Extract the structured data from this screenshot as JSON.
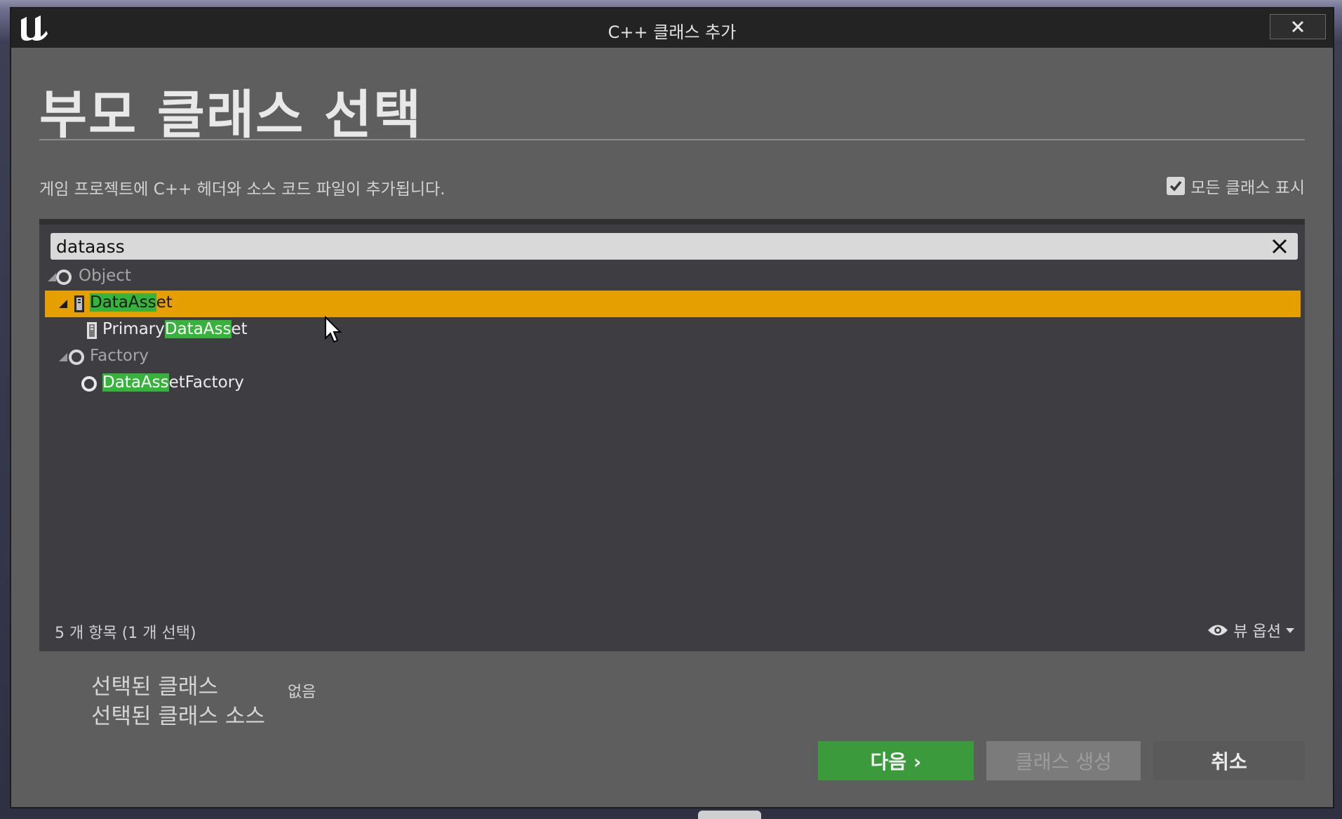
{
  "window": {
    "title": "C++ 클래스 추가"
  },
  "page": {
    "heading": "부모 클래스 선택",
    "description": "게임 프로젝트에 C++ 헤더와 소스 코드 파일이 추가됩니다.",
    "show_all_classes_label": "모든 클래스 표시",
    "show_all_classes_checked": true
  },
  "search": {
    "value": "dataass"
  },
  "tree": {
    "items": [
      {
        "pre": "",
        "match": "",
        "post": "Object",
        "icon": "circle-class-icon"
      },
      {
        "pre": "",
        "match": "DataAss",
        "post": "et",
        "icon": "asset-class-icon",
        "selected": true
      },
      {
        "pre": "Primary",
        "match": "DataAss",
        "post": "et",
        "icon": "asset-class-icon"
      },
      {
        "pre": "",
        "match": "",
        "post": "Factory",
        "icon": "circle-class-icon"
      },
      {
        "pre": "",
        "match": "DataAss",
        "post": "etFactory",
        "icon": "circle-class-icon"
      }
    ]
  },
  "footer": {
    "count": "5 개 항목 (1 개 선택)",
    "view_options": "뷰 옵션"
  },
  "selection": {
    "selected_class_label": "선택된 클래스",
    "selected_class_source_label": "선택된 클래스 소스",
    "selected_class_value": "없음"
  },
  "buttons": {
    "next": "다음 ›",
    "create_class": "클래스 생성",
    "cancel": "취소"
  },
  "colors": {
    "selection": "#e5a000",
    "highlight": "#36b33b",
    "next_button": "#3a9a3c"
  }
}
